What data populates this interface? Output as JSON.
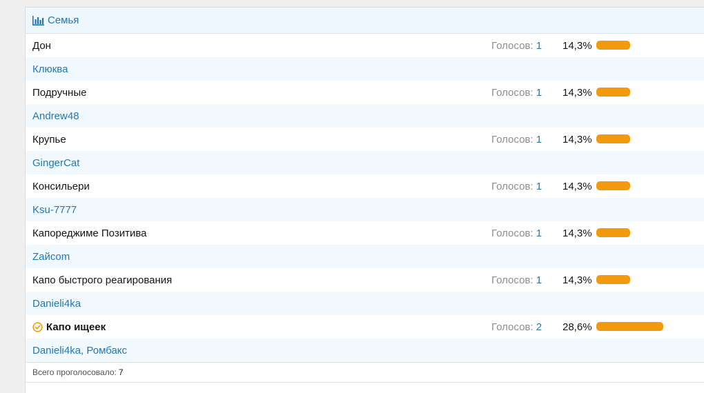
{
  "poll": {
    "title": "Семья",
    "title_icon": "bar-chart-icon",
    "accent_color": "#2577b1",
    "bar_color": "#f29a0e",
    "votes_label": "Голосов:",
    "options": [
      {
        "label": "Дон",
        "votes": "1",
        "percent": "14,3%",
        "fraction": 0.143,
        "voters": "Клюква",
        "chosen": false
      },
      {
        "label": "Подручные",
        "votes": "1",
        "percent": "14,3%",
        "fraction": 0.143,
        "voters": "Andrew48",
        "chosen": false
      },
      {
        "label": "Крупье",
        "votes": "1",
        "percent": "14,3%",
        "fraction": 0.143,
        "voters": "GingerCat",
        "chosen": false
      },
      {
        "label": "Консильери",
        "votes": "1",
        "percent": "14,3%",
        "fraction": 0.143,
        "voters": "Ksu-7777",
        "chosen": false
      },
      {
        "label": "Капореджиме Позитива",
        "votes": "1",
        "percent": "14,3%",
        "fraction": 0.143,
        "voters": "Zaйcom",
        "chosen": false
      },
      {
        "label": "Капо быстрого реагирования",
        "votes": "1",
        "percent": "14,3%",
        "fraction": 0.143,
        "voters": "Danieli4ka",
        "chosen": false
      },
      {
        "label": "Капо ищеек",
        "votes": "2",
        "percent": "28,6%",
        "fraction": 0.286,
        "voters": "Danieli4ka, Ромбакс",
        "chosen": true
      }
    ],
    "footer": {
      "label": "Всего проголосовало:",
      "total": "7"
    }
  }
}
